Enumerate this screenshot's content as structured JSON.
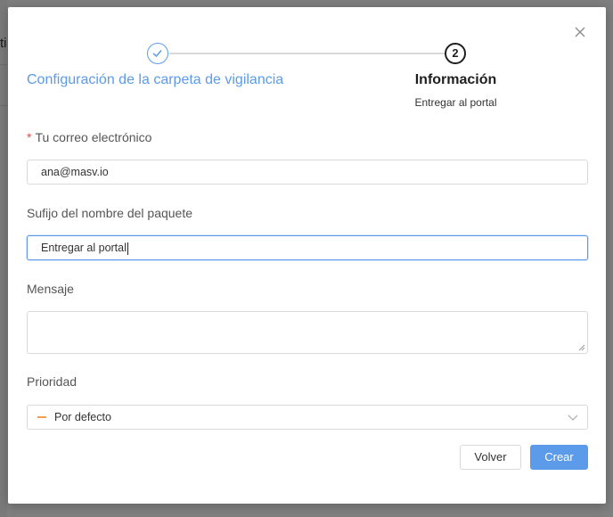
{
  "background": {
    "partial_text": "ti"
  },
  "steps": [
    {
      "number": "1",
      "title": "Configuración de la carpeta de vigilancia",
      "status": "done"
    },
    {
      "number": "2",
      "title": "Información",
      "description": "Entregar al portal",
      "status": "active"
    }
  ],
  "form": {
    "email": {
      "required_mark": "*",
      "label": "Tu correo electrónico",
      "value": "ana@masv.io"
    },
    "suffix": {
      "label": "Sufijo del nombre del paquete",
      "value": "Entregar al portal"
    },
    "message": {
      "label": "Mensaje",
      "value": ""
    },
    "priority": {
      "label": "Prioridad",
      "selected": "Por defecto",
      "indicator_color": "#f0a050"
    }
  },
  "buttons": {
    "back": "Volver",
    "create": "Crear"
  },
  "icons": {
    "close": "close-icon",
    "check": "check-icon",
    "chevron": "chevron-down-icon"
  },
  "colors": {
    "accent": "#5b9bea",
    "required": "#e0504e"
  }
}
